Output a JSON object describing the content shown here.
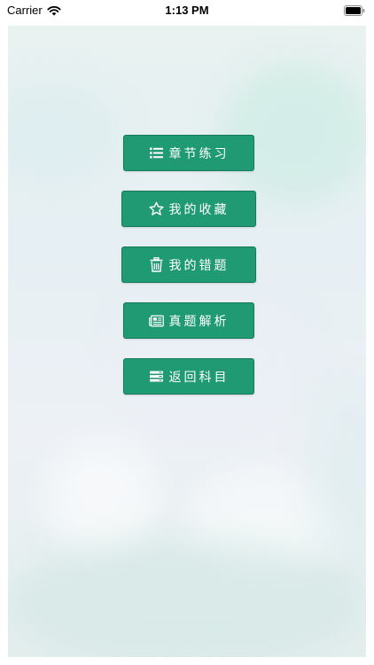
{
  "status_bar": {
    "carrier": "Carrier",
    "time": "1:13 PM"
  },
  "menu": {
    "items": [
      {
        "label": "章节练习",
        "icon": "list-icon"
      },
      {
        "label": "我的收藏",
        "icon": "star-icon"
      },
      {
        "label": "我的错题",
        "icon": "trash-icon"
      },
      {
        "label": "真题解析",
        "icon": "newspaper-icon"
      },
      {
        "label": "返回科目",
        "icon": "stack-icon"
      }
    ]
  },
  "colors": {
    "button": "#1f9a72",
    "button_text": "#ffffff"
  }
}
